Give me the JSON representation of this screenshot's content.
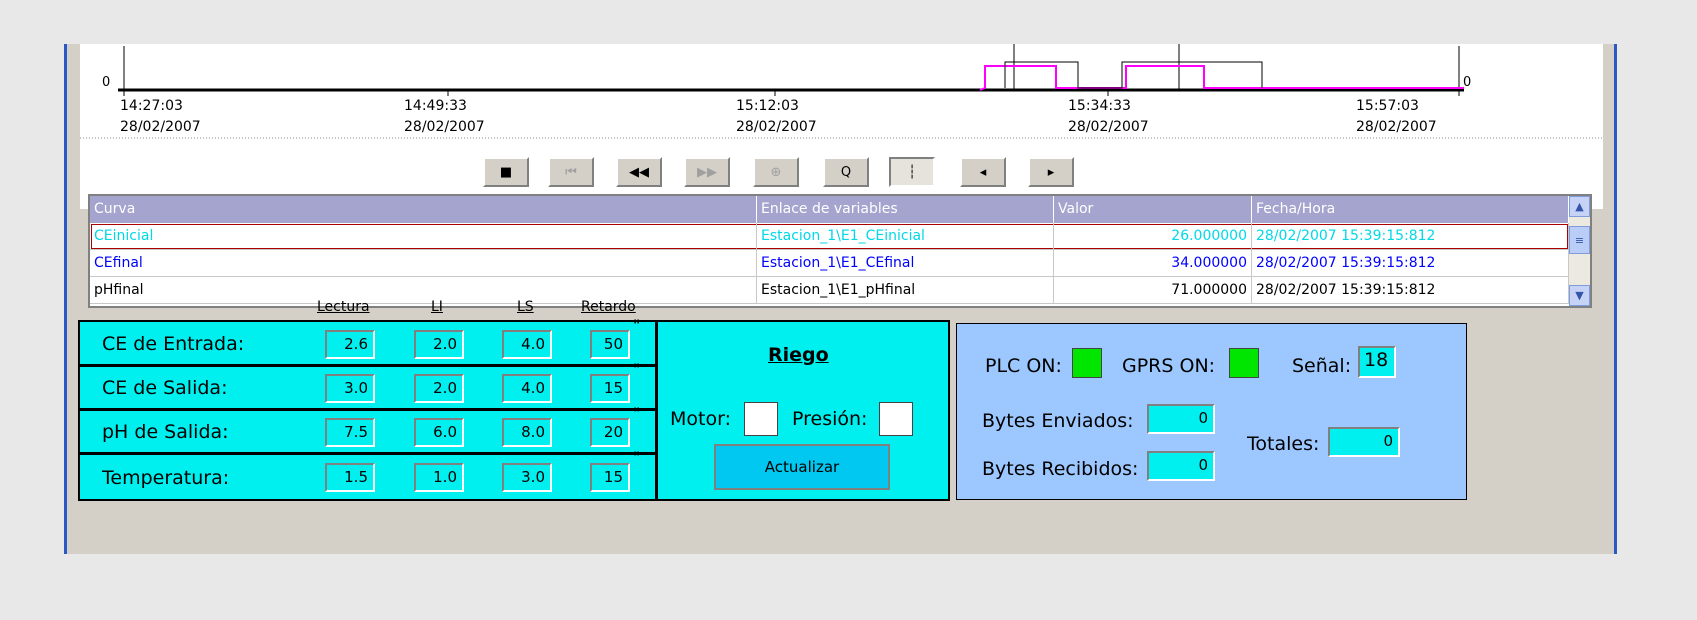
{
  "chart": {
    "y_left_label": "0",
    "y_right_label": "0",
    "time_ticks": [
      {
        "time": "14:27:03",
        "date": "28/02/2007"
      },
      {
        "time": "14:49:33",
        "date": "28/02/2007"
      },
      {
        "time": "15:12:03",
        "date": "28/02/2007"
      },
      {
        "time": "15:34:33",
        "date": "28/02/2007"
      },
      {
        "time": "15:57:03",
        "date": "28/02/2007"
      }
    ]
  },
  "toolbar": {
    "buttons": [
      {
        "name": "stop-button",
        "icon": "■"
      },
      {
        "name": "first-button",
        "icon": "⏮"
      },
      {
        "name": "rewind-button",
        "icon": "◀◀"
      },
      {
        "name": "forward-button",
        "icon": "▶▶"
      },
      {
        "name": "zoom-in-button",
        "icon": "⊕"
      },
      {
        "name": "zoom-out-button",
        "icon": "Q"
      },
      {
        "name": "ruler-button",
        "icon": "┆"
      },
      {
        "name": "previous-curve-button",
        "icon": "◂"
      },
      {
        "name": "next-curve-button",
        "icon": "▸"
      }
    ]
  },
  "table": {
    "headers": [
      "Curva",
      "Enlace de variables",
      "Valor",
      "Fecha/Hora"
    ],
    "rows": [
      {
        "curve": "CEinicial",
        "link": "Estacion_1\\E1_CEinicial",
        "value": "26.000000",
        "datetime": "28/02/2007 15:39:15:812",
        "color": "#00d8e8"
      },
      {
        "curve": "CEfinal",
        "link": "Estacion_1\\E1_CEfinal",
        "value": "34.000000",
        "datetime": "28/02/2007 15:39:15:812",
        "color": "#0000ff"
      },
      {
        "curve": "pHfinal",
        "link": "Estacion_1\\E1_pHfinal",
        "value": "71.000000",
        "datetime": "28/02/2007 15:39:15:812",
        "color": "#000000"
      }
    ]
  },
  "params": {
    "col_headers": [
      "Lectura",
      "LI",
      "LS",
      "Retardo"
    ],
    "rows": [
      {
        "label": "CE de Entrada:",
        "lectura": "2.6",
        "li": "2.0",
        "ls": "4.0",
        "retardo": "50"
      },
      {
        "label": "CE de Salida:",
        "lectura": "3.0",
        "li": "2.0",
        "ls": "4.0",
        "retardo": "15"
      },
      {
        "label": "pH de Salida:",
        "lectura": "7.5",
        "li": "6.0",
        "ls": "8.0",
        "retardo": "20"
      },
      {
        "label": "Temperatura:",
        "lectura": "1.5",
        "li": "1.0",
        "ls": "3.0",
        "retardo": "15"
      }
    ],
    "unit_mark": "\""
  },
  "riego": {
    "title": "Riego",
    "motor_label": "Motor:",
    "presion_label": "Presión:",
    "update_button": "Actualizar"
  },
  "status": {
    "plc_label": "PLC ON:",
    "gprs_label": "GPRS ON:",
    "signal_label": "Señal:",
    "signal_value": "18",
    "bytes_sent_label": "Bytes Enviados:",
    "bytes_sent_value": "0",
    "bytes_received_label": "Bytes Recibidos:",
    "bytes_received_value": "0",
    "totals_label": "Totales:",
    "totals_value": "0",
    "indicator_color": "#00e600"
  }
}
